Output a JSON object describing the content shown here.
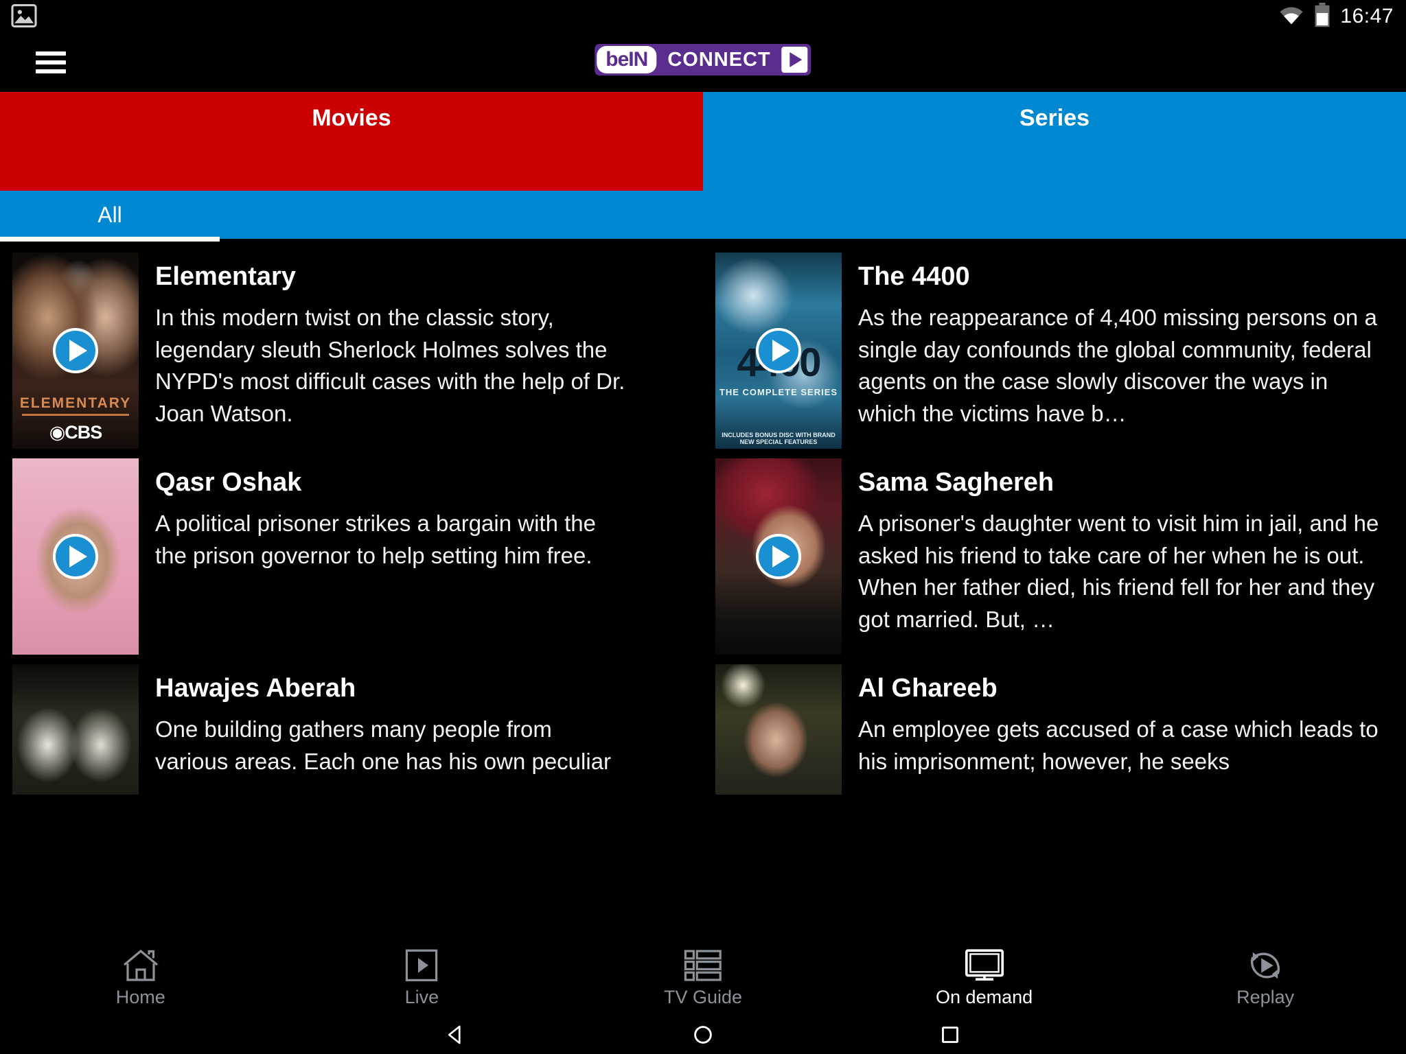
{
  "statusbar": {
    "time": "16:47",
    "icons": [
      "image-icon",
      "wifi-icon",
      "battery-icon"
    ]
  },
  "header": {
    "menu_icon": "hamburger-menu-icon",
    "logo": {
      "bein": "beIN",
      "connect": "CONNECT",
      "play_icon": "play-triangle-icon"
    }
  },
  "main_tabs": [
    {
      "label": "Movies",
      "active": false,
      "color": "#CC0000"
    },
    {
      "label": "Series",
      "active": true,
      "color": "#0089D0"
    }
  ],
  "sub_tabs": [
    {
      "label": "All",
      "active": true
    }
  ],
  "cards": [
    {
      "title": "Elementary",
      "description": "In this modern twist on the classic story, legendary sleuth Sherlock Holmes solves the NYPD's most difficult cases with the help of Dr. Joan Watson.",
      "thumb_caption": "ELEMENTARY",
      "thumb_network": "CBS",
      "play_icon": "play-circle-icon"
    },
    {
      "title": "The 4400",
      "description": "As the reappearance of 4,400 missing persons on a single day confounds the global community, federal agents on the case slowly discover the ways in which the victims have b…",
      "thumb_caption": "THE 4400",
      "thumb_subcaption": "THE COMPLETE SERIES",
      "thumb_footer": "INCLUDES BONUS DISC WITH BRAND NEW SPECIAL FEATURES",
      "play_icon": "play-circle-icon"
    },
    {
      "title": "Qasr Oshak",
      "description": "A political prisoner strikes a bargain with the the prison governor to help setting him free.",
      "play_icon": "play-circle-icon"
    },
    {
      "title": "Sama Saghereh",
      "description": "A prisoner's daughter went to visit him in jail, and he asked his friend to take care of her when he is out. When her father died, his friend fell for her and they got married. But, …",
      "play_icon": "play-circle-icon"
    },
    {
      "title": "Hawajes Aberah",
      "description": "One building gathers many people from various areas. Each one has his own peculiar",
      "play_icon": "play-circle-icon"
    },
    {
      "title": "Al Ghareeb",
      "description": "An employee gets accused of a case which leads to his imprisonment; however, he seeks",
      "play_icon": "play-circle-icon"
    }
  ],
  "bottom_nav": [
    {
      "label": "Home",
      "icon": "home-icon",
      "active": false
    },
    {
      "label": "Live",
      "icon": "live-play-icon",
      "active": false
    },
    {
      "label": "TV Guide",
      "icon": "grid-guide-icon",
      "active": false
    },
    {
      "label": "On demand",
      "icon": "tv-monitor-icon",
      "active": true
    },
    {
      "label": "Replay",
      "icon": "replay-icon",
      "active": false
    }
  ],
  "system_bar": [
    {
      "label": "Back",
      "icon": "back-triangle-icon"
    },
    {
      "label": "Home",
      "icon": "home-circle-icon"
    },
    {
      "label": "Recents",
      "icon": "recents-square-icon"
    }
  ]
}
